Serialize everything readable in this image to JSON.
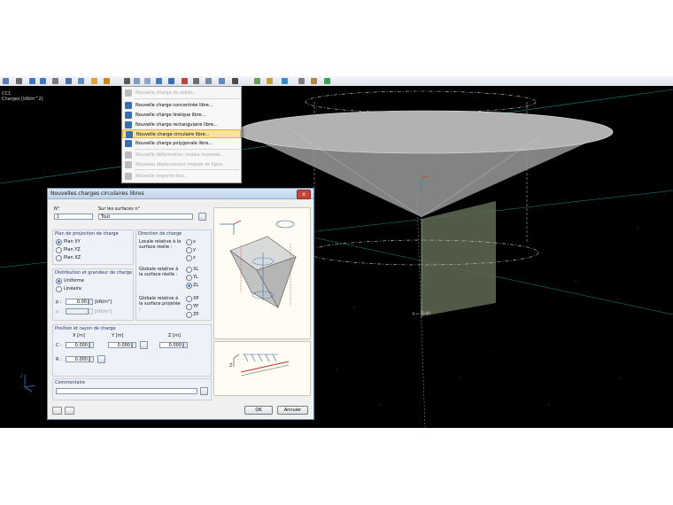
{
  "toolbar": {
    "icons": [
      "new-load-icon",
      "save-icon",
      "undo-icon",
      "redo-icon",
      "select-icon",
      "view-icon",
      "zoom-icon",
      "free-load-icon",
      "load-dropdown-icon",
      "member-icon",
      "surface-icon",
      "solid-icon",
      "node-icon",
      "line-icon",
      "result-icon",
      "display-icon",
      "filter-icon",
      "section-icon",
      "grid-icon",
      "render-icon",
      "color-icon",
      "axis-icon",
      "measure-icon",
      "pencil-icon",
      "check-icon"
    ]
  },
  "viewport": {
    "load_case": "CC1",
    "load_unit": "Charges [kN/m^2]",
    "load_value_label": "p = 10.00"
  },
  "menu": {
    "items": [
      {
        "label": "Nouvelle charge de solide...",
        "enabled": false
      },
      {
        "label": "Nouvelle charge concentrée libre...",
        "enabled": true
      },
      {
        "label": "Nouvelle charge linéique libre...",
        "enabled": true
      },
      {
        "label": "Nouvelle charge rectangulaire libre...",
        "enabled": true
      },
      {
        "label": "Nouvelle charge circulaire libre...",
        "enabled": true,
        "highlighted": true
      },
      {
        "label": "Nouvelle charge polygonale libre...",
        "enabled": true
      },
      {
        "label": "Nouvelle déformation nodale imposée...",
        "enabled": false
      },
      {
        "label": "Nouveau déplacement imposé de ligne...",
        "enabled": false
      },
      {
        "label": "Nouvelle imperfection...",
        "enabled": false
      }
    ]
  },
  "dialog": {
    "title": "Nouvelles charges circulaires libres",
    "close": "x",
    "no_label": "N°",
    "no_value": "1",
    "surfaces_label": "Sur les surfaces n°",
    "surfaces_value": "Tout",
    "projection": {
      "title": "Plan de projection de charge",
      "options": [
        "Plan XY",
        "Plan YZ",
        "Plan XZ"
      ],
      "selected": "Plan XY"
    },
    "distribution": {
      "title": "Distribution et grandeur de charge",
      "options": [
        "Uniforme",
        "Linéaire"
      ],
      "selected": "Uniforme",
      "p_label": "p :",
      "p_value": "0.00",
      "p_unit": "[kN/m²]",
      "p2_label": "p :",
      "p2_value": "",
      "p2_unit": "[kN/m²]"
    },
    "direction": {
      "title": "Direction de charge",
      "local_label": "Locale relative à la surface réelle :",
      "local_options": [
        "x",
        "y",
        "z"
      ],
      "global_label": "Globale relative à la surface réelle :",
      "global_options": [
        "XL",
        "YL",
        "ZL"
      ],
      "projected_label": "Globale relative à la surface projetée :",
      "projected_options": [
        "XP",
        "YP",
        "ZP"
      ],
      "selected": "ZL"
    },
    "position": {
      "title": "Position et rayon de charge",
      "x_header": "X [m]",
      "y_header": "Y [m]",
      "z_header": "Z [m]",
      "c_label": "C :",
      "c_x": "0.000",
      "c_y": "0.000",
      "c_z": "0.000",
      "r_label": "R :",
      "r_value": "0.000"
    },
    "comment": {
      "title": "Commentaire",
      "value": ""
    },
    "ok": "OK",
    "cancel": "Annuler"
  },
  "colors": {
    "viewport_bg": "#000000",
    "highlight": "#fbe39a",
    "dialog_title": "#bfd3ea"
  }
}
